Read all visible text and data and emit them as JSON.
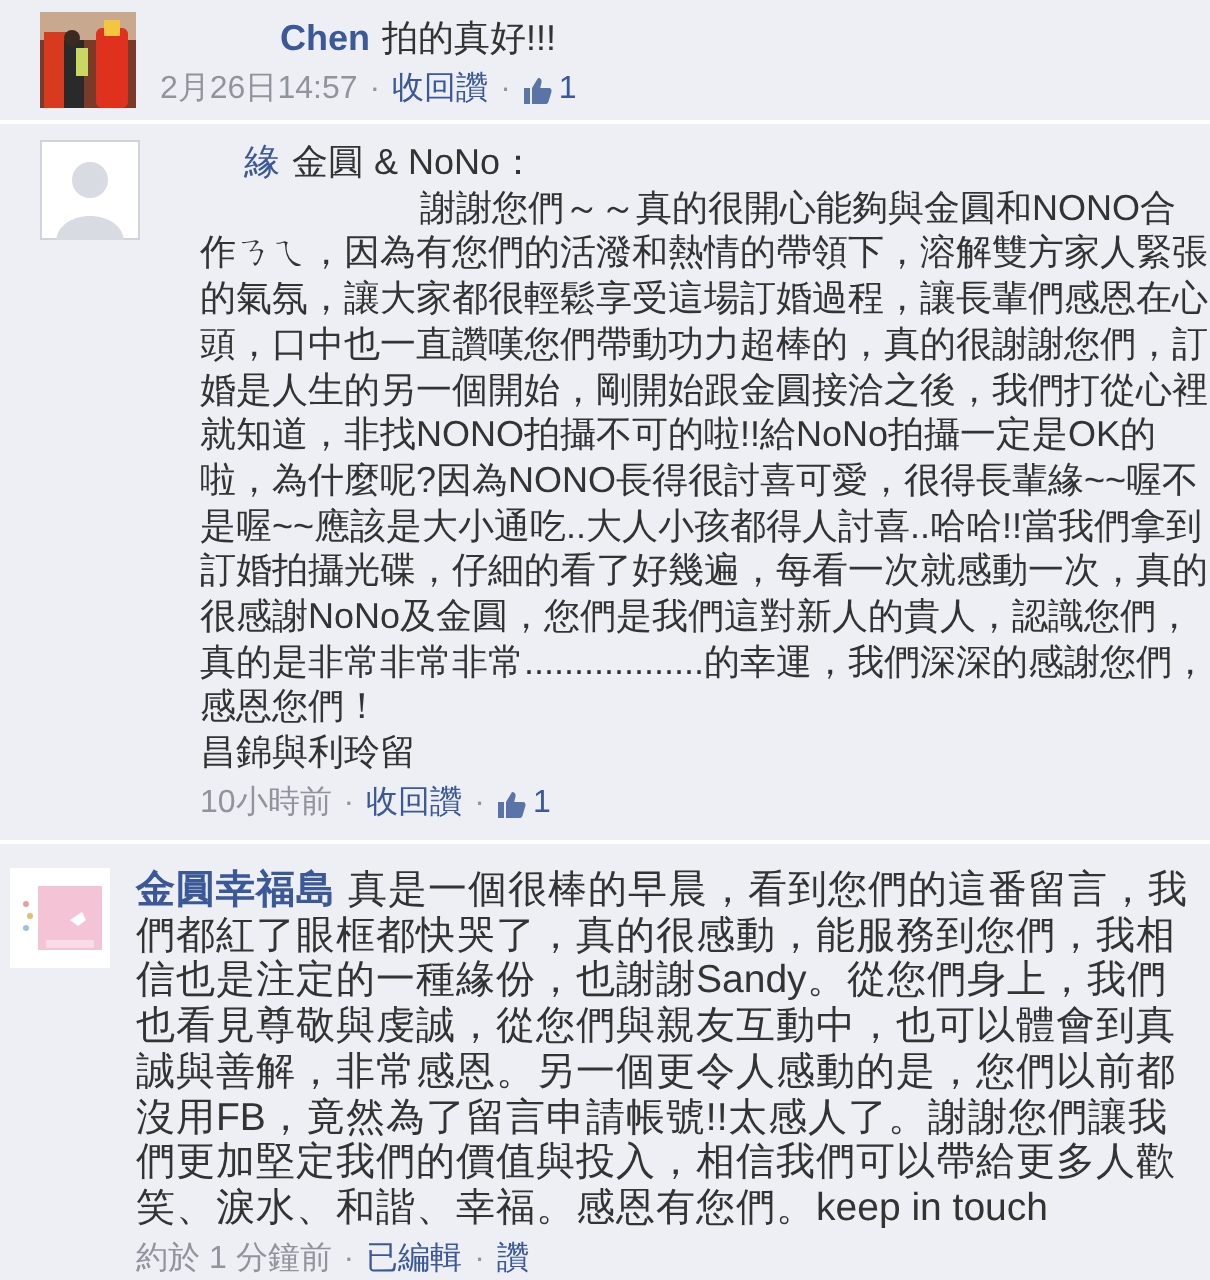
{
  "comments": [
    {
      "author": "Chen",
      "paragraphs": [
        "拍的真好!!!"
      ],
      "meta": [
        {
          "kind": "time",
          "text": "2月26日14:57"
        },
        {
          "kind": "separator",
          "text": "·"
        },
        {
          "kind": "link",
          "text": "收回讚"
        },
        {
          "kind": "separator",
          "text": "·"
        },
        {
          "kind": "likes",
          "text": "1"
        }
      ]
    },
    {
      "avatar": {
        "kind": "default"
      },
      "author": "緣",
      "paragraphs": [
        "金圓 & NoNo：",
        "謝謝您們～～真的很開心能夠與金圓和NONO合作ㄋㄟ，因為有您們的活潑和熱情的帶領下，溶解雙方家人緊張的氣氛，讓大家都很輕鬆享受這場訂婚過程，讓長輩們感恩在心頭，口中也一直讚嘆您們帶動功力超棒的，真的很謝謝您們，訂婚是人生的另一個開始，剛開始跟金圓接洽之後，我們打從心裡就知道，非找NONO拍攝不可的啦!!給NoNo拍攝一定是OK的啦，為什麼呢?因為NONO長得很討喜可愛，很得長輩緣~~喔不是喔~~應該是大小通吃..大人小孩都得人討喜..哈哈!!當我們拿到訂婚拍攝光碟，仔細的看了好幾遍，每看一次就感動一次，真的很感謝NoNo及金圓，您們是我們這對新人的貴人，認識您們，真的是非常非常非常..................的幸運，我們深深的感謝您們，感恩您們！",
        "昌錦與利玲留"
      ],
      "meta": [
        {
          "kind": "time",
          "text": "10小時前"
        },
        {
          "kind": "separator",
          "text": "·"
        },
        {
          "kind": "link",
          "text": "收回讚"
        },
        {
          "kind": "separator",
          "text": "·"
        },
        {
          "kind": "likes",
          "text": "1"
        }
      ]
    },
    {
      "avatar": {
        "kind": "logo"
      },
      "author": "金圓幸福島",
      "paragraphs": [
        "真是一個很棒的早晨，看到您們的這番留言，我們都紅了眼框都快哭了，真的很感動，能服務到您們，我相信也是注定的一種緣份，也謝謝Sandy。從您們身上，我們也看見尊敬與虔誠，從您們與親友互動中，也可以體會到真誠與善解，非常感恩。另一個更令人感動的是，您們以前都沒用FB，竟然為了留言申請帳號!!太感人了。謝謝您們讓我們更加堅定我們的價值與投入，相信我們可以帶給更多人歡笑、淚水、和諧、幸福。感恩有您們。keep in touch"
      ],
      "meta": [
        {
          "kind": "time",
          "text": "約於 1 分鐘前"
        },
        {
          "kind": "separator",
          "text": "·"
        },
        {
          "kind": "link",
          "text": "已編輯"
        },
        {
          "kind": "separator",
          "text": "·"
        },
        {
          "kind": "link",
          "text": "讚"
        }
      ]
    }
  ]
}
